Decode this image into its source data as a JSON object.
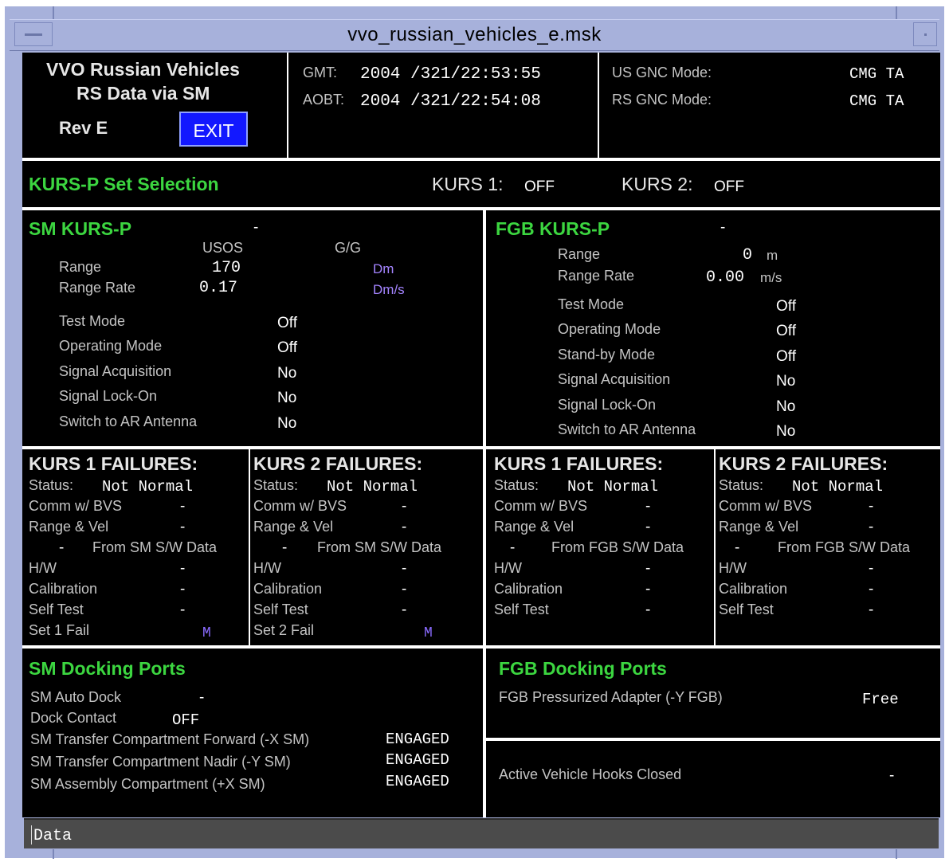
{
  "window": {
    "title": "vvo_russian_vehicles_e.msk"
  },
  "header": {
    "app_title_1": "VVO Russian Vehicles",
    "app_title_2": "RS Data via SM",
    "rev": "Rev E",
    "exit_label": "EXIT",
    "gmt_label": "GMT:",
    "gmt_value": "2004 /321/22:53:55",
    "aobt_label": "AOBT:",
    "aobt_value": "2004 /321/22:54:08",
    "us_gnc_label": "US GNC Mode:",
    "us_gnc_value": "CMG TA",
    "rs_gnc_label": "RS GNC Mode:",
    "rs_gnc_value": "CMG TA"
  },
  "kurs_select": {
    "title": "KURS-P Set Selection",
    "kurs1_label": "KURS 1:",
    "kurs1_value": "OFF",
    "kurs2_label": "KURS 2:",
    "kurs2_value": "OFF"
  },
  "sm_kurs": {
    "title": "SM KURS-P",
    "dash": "-",
    "col_usos": "USOS",
    "col_gg": "G/G",
    "range_label": "Range",
    "range_value": "170",
    "range_unit": "Dm",
    "rate_label": "Range Rate",
    "rate_value": "0.17",
    "rate_unit": "Dm/s",
    "rows": [
      {
        "label": "Test Mode",
        "value": "Off"
      },
      {
        "label": "Operating Mode",
        "value": "Off"
      },
      {
        "label": "Signal Acquisition",
        "value": "No"
      },
      {
        "label": "Signal Lock-On",
        "value": "No"
      },
      {
        "label": "Switch to AR Antenna",
        "value": "No"
      }
    ]
  },
  "fgb_kurs": {
    "title": "FGB KURS-P",
    "dash": "-",
    "range_label": "Range",
    "range_value": "0",
    "range_unit": "m",
    "rate_label": "Range Rate",
    "rate_value": "0.00",
    "rate_unit": "m/s",
    "rows": [
      {
        "label": "Test Mode",
        "value": "Off"
      },
      {
        "label": "Operating Mode",
        "value": "Off"
      },
      {
        "label": "Stand-by Mode",
        "value": "Off"
      },
      {
        "label": "Signal Acquisition",
        "value": "No"
      },
      {
        "label": "Signal Lock-On",
        "value": "No"
      },
      {
        "label": "Switch to AR Antenna",
        "value": "No"
      }
    ]
  },
  "failures": [
    {
      "title": "KURS 1 FAILURES:",
      "status_label": "Status:",
      "status_value": "Not Normal",
      "comm_label": "Comm w/ BVS",
      "comm_value": "-",
      "rv_label": "Range & Vel",
      "rv_value": "-",
      "from_dash": "-",
      "from_label": "From SM S/W Data",
      "hw_label": "H/W",
      "hw_value": "-",
      "cal_label": "Calibration",
      "cal_value": "-",
      "st_label": "Self Test",
      "st_value": "-",
      "fail_label": "Set 1 Fail",
      "fail_value": "M"
    },
    {
      "title": "KURS 2 FAILURES:",
      "status_label": "Status:",
      "status_value": "Not Normal",
      "comm_label": "Comm w/ BVS",
      "comm_value": "-",
      "rv_label": "Range & Vel",
      "rv_value": "-",
      "from_dash": "-",
      "from_label": "From SM S/W Data",
      "hw_label": "H/W",
      "hw_value": "-",
      "cal_label": "Calibration",
      "cal_value": "-",
      "st_label": "Self Test",
      "st_value": "-",
      "fail_label": "Set 2 Fail",
      "fail_value": "M"
    },
    {
      "title": "KURS 1 FAILURES:",
      "status_label": "Status:",
      "status_value": "Not Normal",
      "comm_label": "Comm w/ BVS",
      "comm_value": "-",
      "rv_label": "Range & Vel",
      "rv_value": "-",
      "from_dash": "-",
      "from_label": "From FGB S/W Data",
      "hw_label": "H/W",
      "hw_value": "-",
      "cal_label": "Calibration",
      "cal_value": "-",
      "st_label": "Self Test",
      "st_value": "-"
    },
    {
      "title": "KURS 2 FAILURES:",
      "status_label": "Status:",
      "status_value": "Not Normal",
      "comm_label": "Comm w/ BVS",
      "comm_value": "-",
      "rv_label": "Range & Vel",
      "rv_value": "-",
      "from_dash": "-",
      "from_label": "From FGB S/W Data",
      "hw_label": "H/W",
      "hw_value": "-",
      "cal_label": "Calibration",
      "cal_value": "-",
      "st_label": "Self Test",
      "st_value": "-"
    }
  ],
  "sm_docking": {
    "title": "SM Docking Ports",
    "auto_dock_label": "SM Auto Dock",
    "auto_dock_value": "-",
    "contact_label": "Dock Contact",
    "contact_value": "OFF",
    "rows": [
      {
        "label": "SM Transfer Compartment Forward (-X SM)",
        "value": "ENGAGED"
      },
      {
        "label": "SM Transfer Compartment Nadir (-Y SM)",
        "value": "ENGAGED"
      },
      {
        "label": "SM Assembly Compartment (+X SM)",
        "value": "ENGAGED"
      }
    ]
  },
  "fgb_docking": {
    "title": "FGB Docking Ports",
    "adapter_label": "FGB Pressurized Adapter (-Y FGB)",
    "adapter_value": "Free",
    "hooks_label": "Active Vehicle Hooks Closed",
    "hooks_value": "-"
  },
  "command_line": {
    "value": "Data"
  }
}
